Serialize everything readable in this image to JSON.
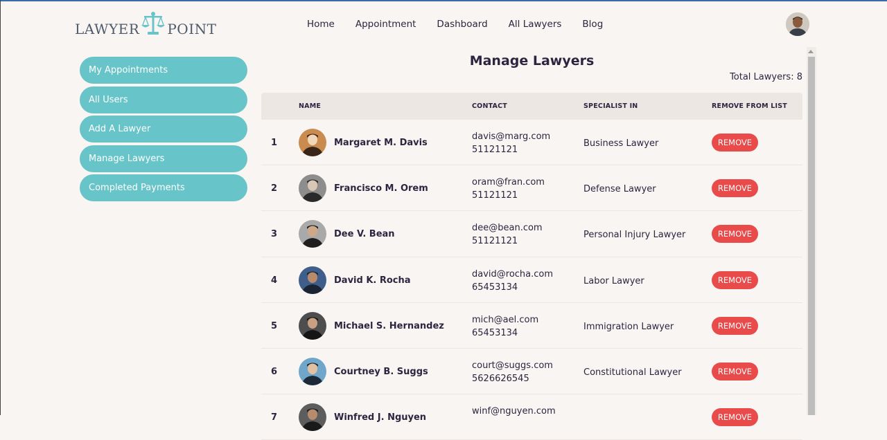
{
  "brand": {
    "left": "LAWYER",
    "right": "POINT"
  },
  "nav": [
    "Home",
    "Appointment",
    "Dashboard",
    "All Lawyers",
    "Blog"
  ],
  "sidebar": [
    "My Appointments",
    "All Users",
    "Add A Lawyer",
    "Manage Lawyers",
    "Completed Payments"
  ],
  "page": {
    "title": "Manage Lawyers",
    "total": "Total Lawyers: 8"
  },
  "table": {
    "headers": {
      "name": "NAME",
      "contact": "CONTACT",
      "specialist": "SPECIALIST IN",
      "remove": "REMOVE FROM LIST"
    },
    "remove_label": "REMOVE",
    "rows": [
      {
        "num": "1",
        "name": "Margaret M. Davis",
        "email": "davis@marg.com",
        "phone": "51121121",
        "spec": "Business Lawyer"
      },
      {
        "num": "2",
        "name": "Francisco M. Orem",
        "email": "oram@fran.com",
        "phone": "51121121",
        "spec": "Defense Lawyer"
      },
      {
        "num": "3",
        "name": "Dee V. Bean",
        "email": "dee@bean.com",
        "phone": "51121121",
        "spec": "Personal Injury Lawyer"
      },
      {
        "num": "4",
        "name": "David K. Rocha",
        "email": "david@rocha.com",
        "phone": "65453134",
        "spec": "Labor Lawyer"
      },
      {
        "num": "5",
        "name": "Michael S. Hernandez",
        "email": "mich@ael.com",
        "phone": "65453134",
        "spec": "Immigration Lawyer"
      },
      {
        "num": "6",
        "name": "Courtney B. Suggs",
        "email": "court@suggs.com",
        "phone": "5626626545",
        "spec": "Constitutional Lawyer"
      },
      {
        "num": "7",
        "name": "Winfred J. Nguyen",
        "email": "winf@nguyen.com",
        "phone": "",
        "spec": ""
      }
    ]
  },
  "colors": {
    "accent": "#67c4c8",
    "danger": "#e94a4a",
    "background": "#f8f5f2",
    "text": "#2b2540"
  }
}
